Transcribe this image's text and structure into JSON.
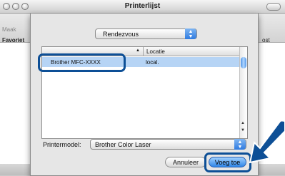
{
  "window": {
    "title": "Printerlijst",
    "toolbar_label": "Maak",
    "column_left": "Favoriet",
    "column_right": "ost"
  },
  "sheet": {
    "connection_popup": "Rendezvous",
    "table": {
      "columns": [
        "",
        "Locatie"
      ],
      "rows": [
        {
          "name": "Brother  MFC-XXXX",
          "location": "local."
        }
      ]
    },
    "printer_model_label": "Printermodel:",
    "printer_model_value": "Brother Color Laser",
    "cancel_label": "Annuleer",
    "add_label": "Voeg toe"
  },
  "colors": {
    "highlight": "#0d4f96",
    "selection": "#b6d4f5",
    "default_button": "#2f86e8"
  }
}
